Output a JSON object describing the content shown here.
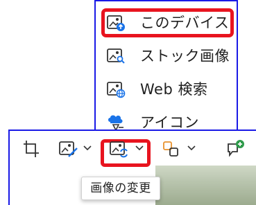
{
  "menu": {
    "items": [
      {
        "label": "このデバイス",
        "icon": "image-upload-icon",
        "highlighted": true
      },
      {
        "label": "ストック画像",
        "icon": "image-search-icon",
        "highlighted": false
      },
      {
        "label": "Web 検索",
        "icon": "image-web-icon",
        "highlighted": false
      },
      {
        "label": "アイコン",
        "icon": "icon-shapes-icon",
        "highlighted": false
      }
    ]
  },
  "toolbar": {
    "buttons": [
      {
        "icon": "crop-icon"
      },
      {
        "icon": "alt-picture-icon",
        "has_dropdown": true
      },
      {
        "icon": "change-picture-icon",
        "has_dropdown": true,
        "highlighted": true
      },
      {
        "icon": "group-icon",
        "has_dropdown": true
      },
      {
        "icon": "new-comment-icon"
      }
    ],
    "tooltip": "画像の変更"
  },
  "colors": {
    "highlight_border": "#e8141f",
    "frame_border": "#1919e6",
    "accent_blue": "#1a73e8",
    "accent_orange": "#e8912b",
    "comment_green": "#2e9a4a"
  }
}
